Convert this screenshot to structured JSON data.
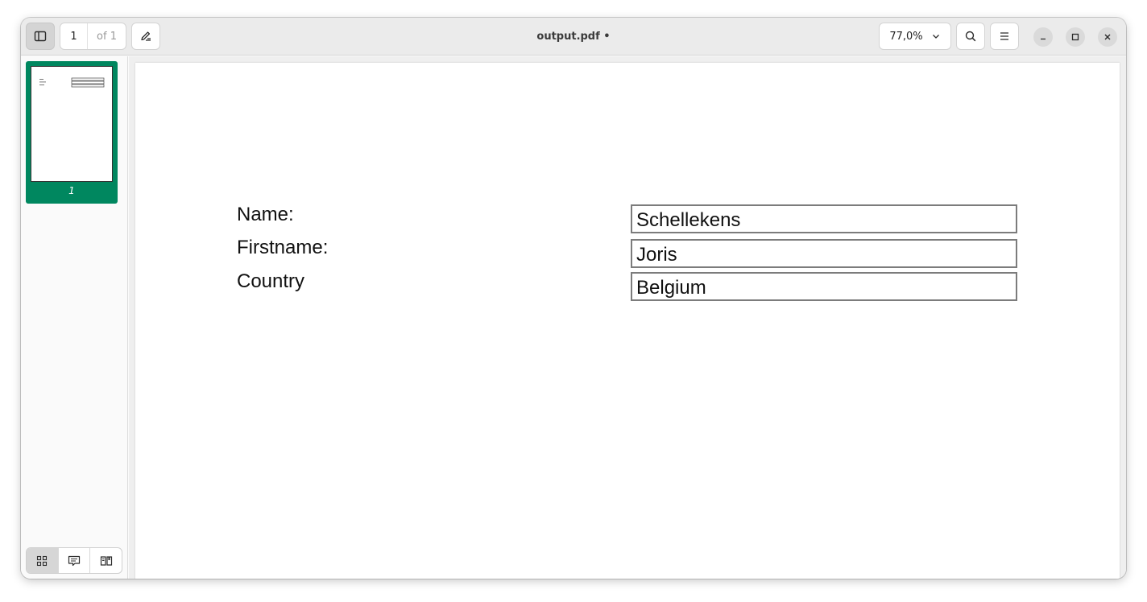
{
  "window": {
    "title": "output.pdf •"
  },
  "toolbar": {
    "page_current": "1",
    "page_total": "of 1",
    "zoom": "77,0%"
  },
  "icons": {
    "sidebar_toggle": "sidebar-icon",
    "annotate": "pen-icon",
    "zoom_dropdown": "chevron-down-icon",
    "search": "search-icon",
    "menu": "hamburger-menu-icon",
    "minimize": "minimize-icon",
    "maximize": "maximize-icon",
    "close": "close-icon",
    "thumbnails_view": "grid-icon",
    "annotations_view": "comment-icon",
    "outline_view": "book-icon"
  },
  "sidebar": {
    "thumbnail_label": "1"
  },
  "document": {
    "fields": [
      {
        "label": "Name:",
        "value": "Schellekens"
      },
      {
        "label": "Firstname:",
        "value": "Joris"
      },
      {
        "label": "Country",
        "value": "Belgium"
      }
    ]
  },
  "colors": {
    "accent": "#00875f",
    "headerbar": "#ebebeb",
    "field_border": "#7c7c7c"
  }
}
